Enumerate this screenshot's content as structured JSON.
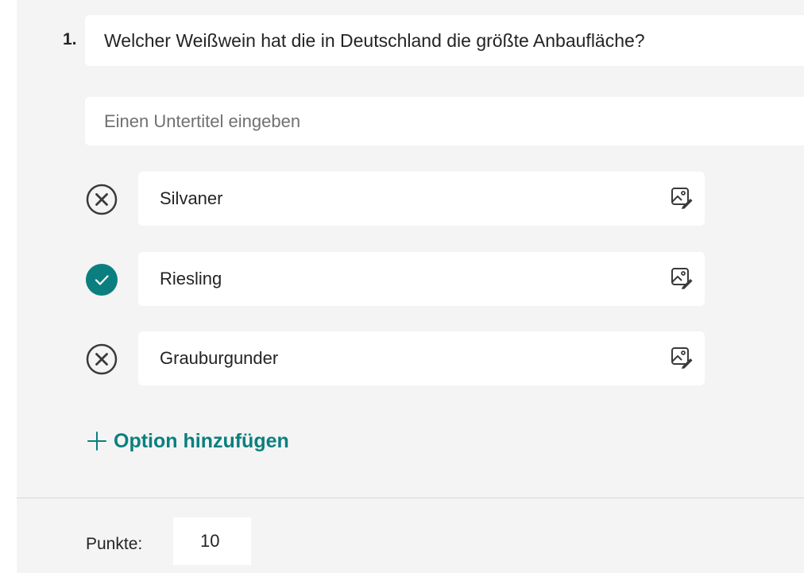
{
  "question": {
    "number": "1.",
    "title": "Welcher Weißwein hat die in Deutschland die größte Anbaufläche?",
    "subtitle_placeholder": "Einen Untertitel eingeben"
  },
  "options": [
    {
      "label": "Silvaner",
      "status": "incorrect",
      "icon": "x-circle-icon",
      "image_icon": "insert-image-icon"
    },
    {
      "label": "Riesling",
      "status": "correct",
      "icon": "check-circle-icon",
      "image_icon": "insert-image-icon"
    },
    {
      "label": "Grauburgunder",
      "status": "incorrect",
      "icon": "x-circle-icon",
      "image_icon": "insert-image-icon"
    }
  ],
  "add_option": {
    "label": "Option hinzufügen",
    "icon": "plus-icon"
  },
  "points": {
    "label": "Punkte:",
    "value": "10"
  },
  "colors": {
    "accent": "#0b7f7f",
    "background": "#f4f4f4",
    "field": "#ffffff",
    "text": "#242424",
    "placeholder": "#707070"
  }
}
